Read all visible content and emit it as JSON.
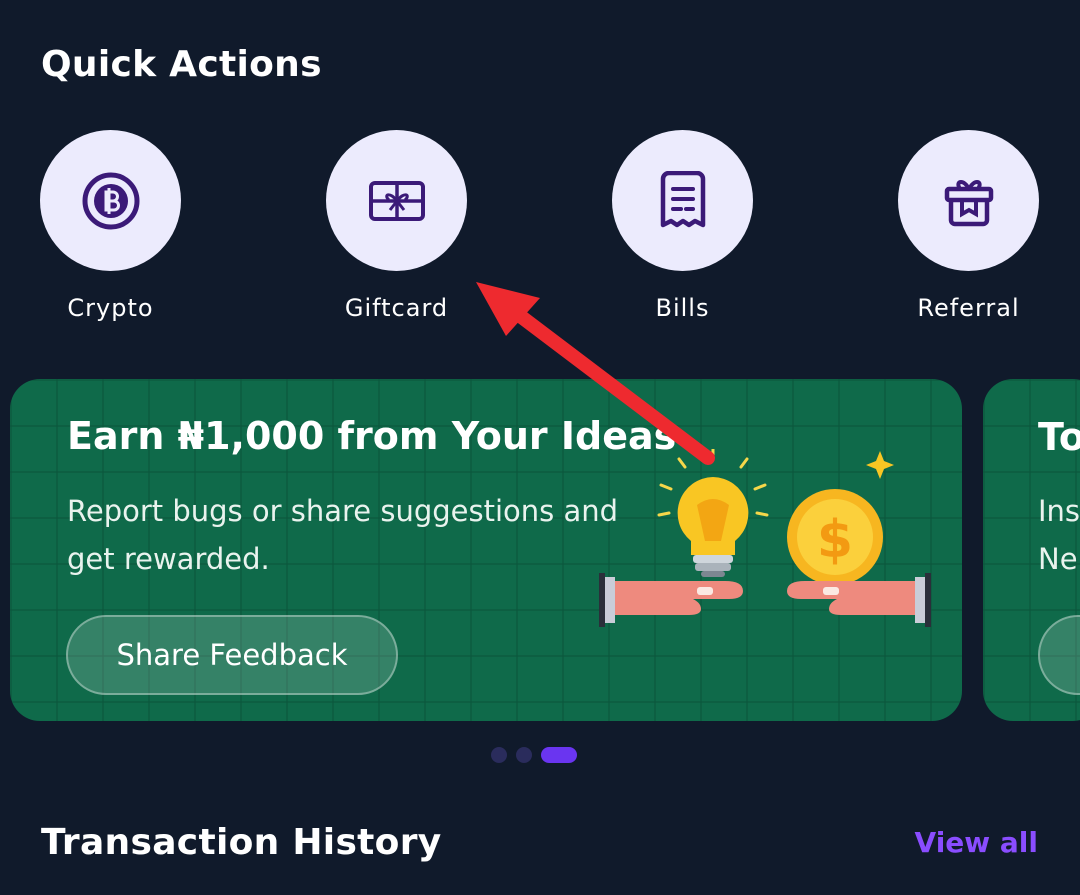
{
  "quick_actions": {
    "title": "Quick Actions",
    "items": [
      {
        "label": "Crypto",
        "icon": "crypto-coin-icon"
      },
      {
        "label": "Giftcard",
        "icon": "giftcard-icon"
      },
      {
        "label": "Bills",
        "icon": "bill-receipt-icon"
      },
      {
        "label": "Referral",
        "icon": "gift-box-icon"
      }
    ]
  },
  "promo_banner": {
    "title": "Earn ₦1,000 from Your Ideas",
    "subtitle": "Report bugs or share suggestions and get rewarded.",
    "button": "Share Feedback",
    "background": "#0f6a4a"
  },
  "next_banner": {
    "title_partial": "To",
    "sub_line1": "Inst",
    "sub_line2": "Ne"
  },
  "carousel": {
    "count": 3,
    "active_index": 2
  },
  "transaction_history": {
    "title": "Transaction History",
    "view_all": "View all"
  },
  "colors": {
    "background": "#101a2b",
    "accent": "#8a4dff",
    "icon_circle": "#ecebfd",
    "icon_stroke": "#3b1a78",
    "annotation_arrow": "#ee2a2f"
  }
}
